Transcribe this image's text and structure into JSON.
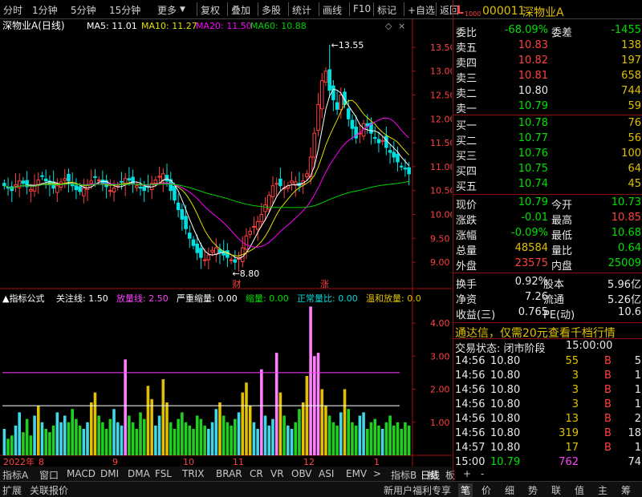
{
  "toolbar": {
    "left_items": [
      "分时",
      "1分钟",
      "5分钟",
      "15分钟",
      "更多"
    ],
    "right_items": [
      "复权",
      "叠加",
      "多股",
      "统计",
      "画线",
      "F10",
      "标记",
      "+自选",
      "返回"
    ]
  },
  "stock": {
    "code": "000011",
    "name": "深物业A",
    "level_badge": "L",
    "level_sub": "1000"
  },
  "colors": {
    "up": "#ff4040",
    "down": "#00e0e0",
    "ma5": "#ffffff",
    "ma10": "#e0e000",
    "ma20": "#ff00ff",
    "ma60": "#00d000",
    "volume_up": "#ff8080",
    "volume_down": "#00d8d8",
    "attention": "#ffffff",
    "amplify": "#ff40ff"
  },
  "chart_data": [
    {
      "type": "candlestick",
      "title": "深物业A(日线)",
      "ma_labels": [
        {
          "name": "MA5",
          "value": "11.01"
        },
        {
          "name": "MA10",
          "value": "11.27"
        },
        {
          "name": "MA20",
          "value": "11.50"
        },
        {
          "name": "MA60",
          "value": "10.88"
        }
      ],
      "y_ticks": [
        "13.50",
        "13.00",
        "12.50",
        "12.00",
        "11.50",
        "11.00",
        "10.50",
        "10.00",
        "9.50",
        "9.00"
      ],
      "ylim": [
        8.75,
        13.75
      ],
      "x_ticks": [
        "2022年",
        "8",
        "9",
        "10",
        "11",
        "12",
        "1"
      ],
      "annotations": [
        {
          "text": "13.55",
          "value": 13.55
        },
        {
          "text": "8.80",
          "value": 8.8
        }
      ],
      "markers": [
        "财",
        "涨"
      ],
      "close": [
        10.6,
        10.55,
        10.5,
        10.62,
        10.7,
        10.65,
        10.58,
        10.52,
        10.6,
        10.72,
        10.8,
        10.7,
        10.62,
        10.55,
        10.6,
        10.68,
        10.75,
        10.7,
        10.6,
        10.52,
        10.48,
        10.55,
        10.62,
        10.7,
        10.78,
        10.72,
        10.65,
        10.58,
        10.5,
        10.55,
        10.6,
        10.68,
        10.75,
        10.72,
        10.65,
        10.6,
        10.55,
        10.5,
        10.58,
        10.65,
        10.72,
        10.8,
        10.85,
        10.7,
        10.5,
        10.3,
        10.1,
        9.9,
        9.7,
        9.5,
        9.35,
        9.2,
        9.1,
        9.05,
        9.15,
        9.25,
        9.3,
        9.2,
        9.15,
        9.1,
        9.05,
        9.0,
        9.1,
        9.3,
        9.55,
        9.65,
        9.75,
        9.85,
        10.0,
        10.2,
        10.4,
        10.6,
        10.65,
        10.6,
        10.55,
        10.6,
        10.7,
        10.68,
        10.6,
        10.7,
        10.85,
        11.2,
        11.7,
        12.3,
        12.8,
        13.0,
        12.6,
        12.4,
        12.2,
        12.5,
        12.3,
        12.0,
        11.8,
        11.6,
        11.7,
        11.9,
        11.85,
        11.7,
        11.6,
        11.5,
        11.55,
        11.4,
        11.3,
        11.2,
        11.1,
        11.0,
        10.95,
        10.85
      ],
      "ma_series": {
        "note": "computed"
      }
    },
    {
      "type": "bar",
      "title": "指标公式",
      "indicator_labels": [
        {
          "name": "关注线",
          "value": "1.50"
        },
        {
          "name": "放量线",
          "value": "2.50"
        },
        {
          "name": "严重缩量",
          "value": "0.00"
        },
        {
          "name": "缩量",
          "value": "0.00"
        },
        {
          "name": "正常量比",
          "value": "0.00"
        },
        {
          "name": "温和放量",
          "value": "0.0"
        }
      ],
      "y_ticks": [
        "4.00",
        "3.00",
        "2.00",
        "1.00"
      ],
      "ylim": [
        0,
        4.8
      ],
      "lines": [
        {
          "name": "关注线",
          "value": 1.5
        },
        {
          "name": "放量线",
          "value": 2.5
        }
      ],
      "values": [
        0.8,
        0.5,
        0.6,
        0.9,
        1.3,
        0.7,
        1.1,
        0.6,
        1.2,
        1.5,
        1.0,
        0.8,
        0.7,
        0.9,
        1.3,
        1.0,
        1.2,
        1.0,
        1.4,
        1.1,
        0.9,
        0.8,
        1.0,
        1.6,
        1.9,
        1.2,
        1.0,
        0.8,
        1.1,
        1.4,
        1.0,
        0.9,
        2.9,
        1.2,
        1.0,
        0.8,
        1.3,
        1.1,
        2.1,
        1.7,
        0.9,
        1.2,
        2.3,
        1.6,
        1.0,
        0.8,
        1.1,
        1.3,
        1.0,
        0.9,
        0.8,
        1.2,
        1.1,
        0.9,
        0.8,
        1.0,
        1.4,
        1.6,
        1.2,
        1.0,
        0.9,
        1.1,
        1.3,
        1.9,
        2.2,
        1.5,
        1.0,
        0.8,
        2.6,
        1.2,
        0.9,
        1.1,
        3.1,
        1.9,
        1.2,
        0.9,
        0.8,
        1.0,
        1.4,
        1.6,
        2.4,
        4.5,
        3.0,
        3.1,
        2.0,
        1.5,
        1.2,
        1.0,
        0.9,
        1.3,
        2.0,
        1.4,
        1.0,
        0.9,
        1.2,
        1.3,
        0.8,
        1.0,
        1.1,
        0.9,
        0.8,
        1.0,
        1.2,
        0.9,
        1.0,
        0.8,
        1.0,
        0.9
      ]
    }
  ],
  "bottom_tabs": [
    "指标A",
    "窗口",
    "MACD",
    "DMI",
    "DMA",
    "FSL",
    "TRIX",
    "BRAR",
    "CR",
    "VR",
    "OBV",
    "ASI",
    "EMV",
    ">",
    "指标B",
    "模",
    "板",
    "+",
    "-"
  ],
  "period_label": "日线",
  "quotes": {
    "wei_bi_label": "委比",
    "wei_bi": "-68.09%",
    "wei_cha_label": "委差",
    "wei_cha": "-1455",
    "sell": [
      {
        "label": "卖五",
        "price": "10.83",
        "vol": "138"
      },
      {
        "label": "卖四",
        "price": "10.82",
        "vol": "197"
      },
      {
        "label": "卖三",
        "price": "10.81",
        "vol": "658"
      },
      {
        "label": "卖二",
        "price": "10.80",
        "vol": "744"
      },
      {
        "label": "卖一",
        "price": "10.79",
        "vol": "59"
      }
    ],
    "buy": [
      {
        "label": "买一",
        "price": "10.78",
        "vol": "76"
      },
      {
        "label": "买二",
        "price": "10.77",
        "vol": "56"
      },
      {
        "label": "买三",
        "price": "10.76",
        "vol": "100"
      },
      {
        "label": "买四",
        "price": "10.75",
        "vol": "64"
      },
      {
        "label": "买五",
        "price": "10.74",
        "vol": "45"
      }
    ],
    "stats": [
      {
        "l1": "现价",
        "v1": "10.79",
        "c1": "grn",
        "l2": "今开",
        "v2": "10.73",
        "c2": "grn"
      },
      {
        "l1": "涨跌",
        "v1": "-0.01",
        "c1": "grn",
        "l2": "最高",
        "v2": "10.85",
        "c2": "red"
      },
      {
        "l1": "涨幅",
        "v1": "-0.09%",
        "c1": "grn",
        "l2": "最低",
        "v2": "10.68",
        "c2": "grn"
      },
      {
        "l1": "总量",
        "v1": "48584",
        "c1": "yel",
        "l2": "量比",
        "v2": "0.64",
        "c2": "grn"
      },
      {
        "l1": "外盘",
        "v1": "23575",
        "c1": "red",
        "l2": "内盘",
        "v2": "25009",
        "c2": "grn"
      }
    ],
    "stats2": [
      {
        "l1": "换手",
        "v1": "0.92%",
        "l2": "股本",
        "v2": "5.96亿"
      },
      {
        "l1": "净资",
        "v1": "7.26",
        "l2": "流通",
        "v2": "5.26亿"
      },
      {
        "l1": "收益(三)",
        "v1": "0.765",
        "l2": "PE(动)",
        "v2": "10.6"
      }
    ]
  },
  "ad_text": "通达信，仅需20元查看千档行情",
  "trade_status": {
    "label": "交易状态: 闭市阶段",
    "time": "15:00:00"
  },
  "ticks": [
    {
      "time": "14:56",
      "price": "10.80",
      "vol": "55",
      "side": "B",
      "n": "5"
    },
    {
      "time": "14:56",
      "price": "10.80",
      "vol": "3",
      "side": "B",
      "n": "1"
    },
    {
      "time": "14:56",
      "price": "10.80",
      "vol": "3",
      "side": "B",
      "n": "1"
    },
    {
      "time": "14:56",
      "price": "10.80",
      "vol": "3",
      "side": "B",
      "n": "1"
    },
    {
      "time": "14:56",
      "price": "10.80",
      "vol": "13",
      "side": "B",
      "n": "2"
    },
    {
      "time": "14:56",
      "price": "10.80",
      "vol": "319",
      "side": "B",
      "n": "18"
    },
    {
      "time": "14:57",
      "price": "10.80",
      "vol": "17",
      "side": "B",
      "n": "1"
    },
    {
      "time": "15:00",
      "price": "10.79",
      "vol": "762",
      "side": "",
      "n": "74"
    }
  ],
  "status_left": [
    "扩展",
    "关联报价"
  ],
  "status_mid": "新用户福利专享",
  "status_right": [
    "笔",
    "价",
    "细",
    "势",
    "联",
    "值",
    "主",
    "筹"
  ]
}
